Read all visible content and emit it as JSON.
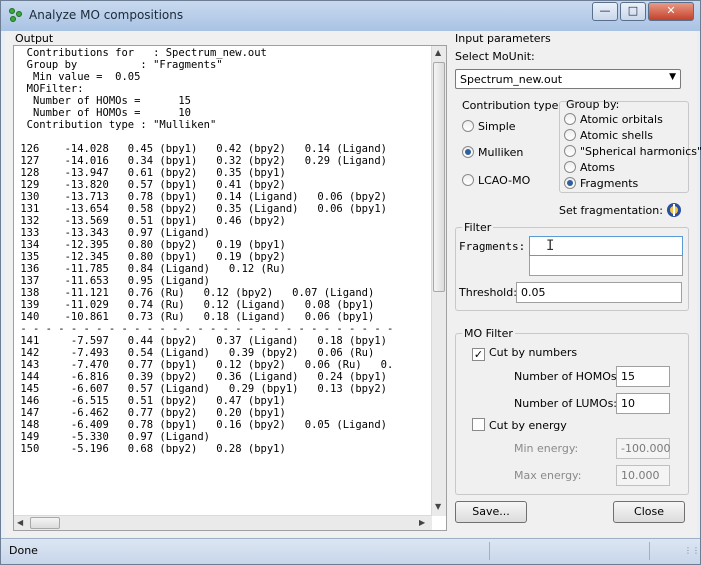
{
  "window": {
    "title": "Analyze MO compositions",
    "icon": "molecule-app-icon"
  },
  "output": {
    "label": "Output",
    "lines": [
      "  Contributions for   : Spectrum_new.out",
      "  Group by          : \"Fragments\"",
      "   Min value =  0.05",
      "  MOFilter:",
      "   Number of HOMOs =      15",
      "   Number of HOMOs =      10",
      "  Contribution type : \"Mulliken\"",
      "",
      " 126    -14.028   0.45 (bpy1)   0.42 (bpy2)   0.14 (Ligand)",
      " 127    -14.016   0.34 (bpy1)   0.32 (bpy2)   0.29 (Ligand)",
      " 128    -13.947   0.61 (bpy2)   0.35 (bpy1)",
      " 129    -13.820   0.57 (bpy1)   0.41 (bpy2)",
      " 130    -13.713   0.78 (bpy1)   0.14 (Ligand)   0.06 (bpy2)",
      " 131    -13.654   0.58 (bpy2)   0.35 (Ligand)   0.06 (bpy1)",
      " 132    -13.569   0.51 (bpy1)   0.46 (bpy2)",
      " 133    -13.343   0.97 (Ligand)",
      " 134    -12.395   0.80 (bpy2)   0.19 (bpy1)",
      " 135    -12.345   0.80 (bpy1)   0.19 (bpy2)",
      " 136    -11.785   0.84 (Ligand)   0.12 (Ru)",
      " 137    -11.653   0.95 (Ligand)",
      " 138    -11.121   0.76 (Ru)   0.12 (bpy2)   0.07 (Ligand)",
      " 139    -11.029   0.74 (Ru)   0.12 (Ligand)   0.08 (bpy1)",
      " 140    -10.861   0.73 (Ru)   0.18 (Ligand)   0.06 (bpy1)",
      " - - - - - - - - - - - - - - - - - - - - - - - - - - - - - -",
      " 141     -7.597   0.44 (bpy2)   0.37 (Ligand)   0.18 (bpy1)",
      " 142     -7.493   0.54 (Ligand)   0.39 (bpy2)   0.06 (Ru)",
      " 143     -7.470   0.77 (bpy1)   0.12 (bpy2)   0.06 (Ru)   0.",
      " 144     -6.816   0.39 (bpy2)   0.36 (Ligand)   0.24 (bpy1)",
      " 145     -6.607   0.57 (Ligand)   0.29 (bpy1)   0.13 (bpy2)",
      " 146     -6.515   0.51 (bpy2)   0.47 (bpy1)",
      " 147     -6.462   0.77 (bpy2)   0.20 (bpy1)",
      " 148     -6.409   0.78 (bpy1)   0.16 (bpy2)   0.05 (Ligand)",
      " 149     -5.330   0.97 (Ligand)",
      " 150     -5.196   0.68 (bpy2)   0.28 (bpy1)"
    ]
  },
  "input": {
    "label": "Input parameters",
    "select_label": "Select MoUnit:",
    "select_value": "Spectrum_new.out",
    "contribution": {
      "label": "Contribution type",
      "options": [
        "Simple",
        "Mulliken",
        "LCAO-MO"
      ],
      "selected": 1
    },
    "groupby": {
      "label": "Group by:",
      "options": [
        "Atomic orbitals",
        "Atomic shells",
        "\"Spherical harmonics\"",
        "Atoms",
        "Fragments"
      ],
      "selected": 4
    },
    "set_fragmentation_label": "Set fragmentation:",
    "filter": {
      "label": "Filter",
      "fragments_label": "Fragments:",
      "fragments_value": "",
      "threshold_label": "Threshold:",
      "threshold_value": "0.05"
    },
    "mofilter": {
      "label": "MO Filter",
      "cut_numbers_label": "Cut by numbers",
      "homos_label": "Number of HOMOs:",
      "homos_value": "15",
      "lumos_label": "Number of LUMOs:",
      "lumos_value": "10",
      "cut_energy_label": "Cut by energy",
      "min_label": "Min energy:",
      "min_value": "-100.000",
      "max_label": "Max energy:",
      "max_value": "10.000"
    },
    "save_label": "Save...",
    "close_label": "Close"
  },
  "status": {
    "text": "Done"
  }
}
